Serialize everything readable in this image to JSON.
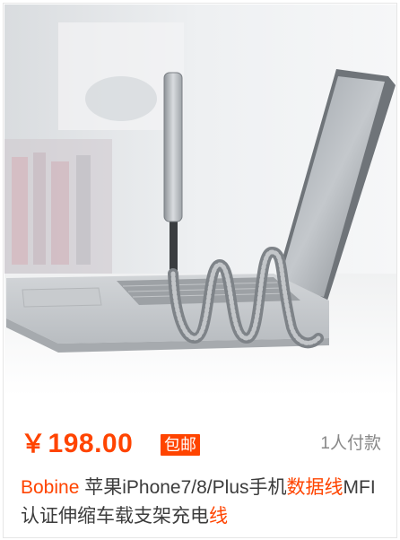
{
  "product": {
    "price_symbol": "￥",
    "price_value": "198.00",
    "shipping_badge": "包邮",
    "sold_count": "1人付款",
    "title_parts": [
      {
        "text": "Bobine",
        "highlight": true
      },
      {
        "text": " 苹果iPhone7/8/Plus手机",
        "highlight": false
      },
      {
        "text": "数据线",
        "highlight": true
      },
      {
        "text": "MFI认证伸缩车载支架充电",
        "highlight": false
      },
      {
        "text": "线",
        "highlight": true
      }
    ],
    "image_description_icon": "laptop-with-spring-cable-phone-mount-image"
  },
  "colors": {
    "accent": "#ff4400",
    "muted": "#888888",
    "title": "#3c3c3c",
    "border": "#e6e6e6"
  }
}
